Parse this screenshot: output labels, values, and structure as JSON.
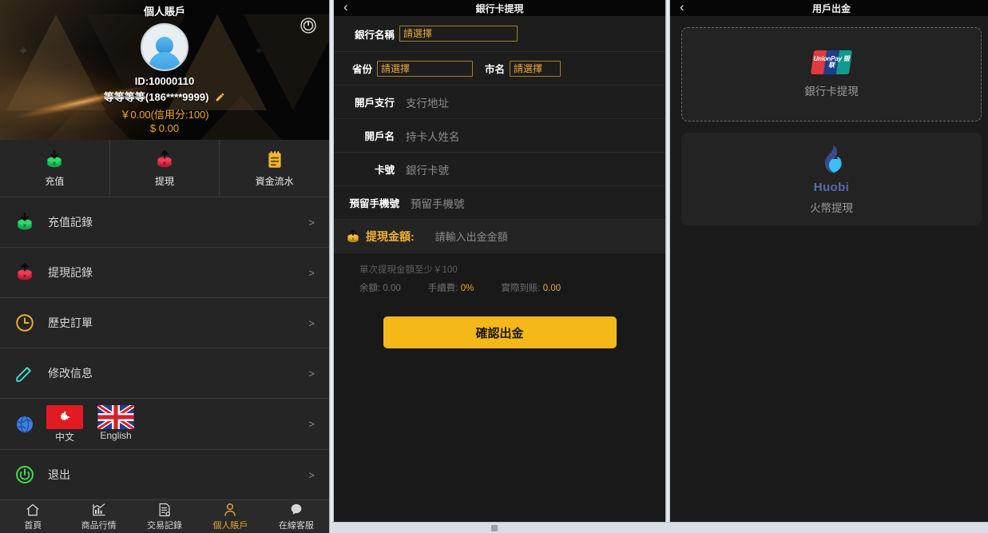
{
  "account_panel": {
    "title": "個人賬戶",
    "power_icon": "power-icon",
    "user_id": "ID:10000110",
    "user_name": "等等等等(186****9999)",
    "edit_icon": "pencil-icon",
    "balance_cny": "￥0.00(信用分:100)",
    "balance_usd": "$ 0.00",
    "quick_actions": [
      {
        "label": "充值",
        "icon": "deposit-icon",
        "color": "#22c55e"
      },
      {
        "label": "提現",
        "icon": "withdraw-icon",
        "color": "#e8344e"
      },
      {
        "label": "資金流水",
        "icon": "ledger-icon",
        "color": "#f0b135"
      }
    ],
    "menu": [
      {
        "label": "充值記錄",
        "icon": "deposit-icon",
        "arrow": ">"
      },
      {
        "label": "提現記錄",
        "icon": "withdraw-icon",
        "arrow": ">"
      },
      {
        "label": "歷史訂單",
        "icon": "clock-icon",
        "arrow": ">"
      },
      {
        "label": "修改信息",
        "icon": "pencil-icon",
        "arrow": ">"
      },
      {
        "label": "",
        "icon": "globe-icon",
        "arrow": ">"
      },
      {
        "label": "退出",
        "icon": "power-icon",
        "arrow": ">"
      }
    ],
    "languages": [
      {
        "label": "中文",
        "flag": "hk-flag-icon"
      },
      {
        "label": "English",
        "flag": "uk-flag-icon"
      }
    ],
    "tabbar": [
      {
        "label": "首頁",
        "icon": "home-icon",
        "active": false
      },
      {
        "label": "商品行情",
        "icon": "chart-icon",
        "active": false
      },
      {
        "label": "交易記錄",
        "icon": "records-icon",
        "active": false
      },
      {
        "label": "個人賬戶",
        "icon": "person-icon",
        "active": true
      },
      {
        "label": "在線客服",
        "icon": "support-icon",
        "active": false
      }
    ]
  },
  "bank_panel": {
    "title": "銀行卡提現",
    "back_icon": "chevron-left-icon",
    "bank_name_label": "銀行名稱",
    "bank_name_value": "請選擇",
    "province_label": "省份",
    "province_value": "請選擇",
    "city_label": "市名",
    "city_value": "請選擇",
    "branch_label": "開戶支行",
    "branch_placeholder": "支行地址",
    "holder_label": "開戶名",
    "holder_placeholder": "持卡人姓名",
    "card_label": "卡號",
    "card_placeholder": "銀行卡號",
    "phone_label": "預留手機號",
    "phone_placeholder": "預留手機號",
    "amount_label": "提現金額:",
    "amount_placeholder": "請輸入出金金額",
    "min_hint": "單次提現金額至少￥100",
    "stats": [
      {
        "key": "余額:",
        "value": "0.00",
        "gold": false
      },
      {
        "key": "手續費:",
        "value": "0%",
        "gold": true
      },
      {
        "key": "實際到賬:",
        "value": "0.00",
        "gold": true
      }
    ],
    "confirm_label": "確認出金"
  },
  "methods_panel": {
    "title": "用戶出金",
    "back_icon": "chevron-left-icon",
    "methods": [
      {
        "label": "銀行卡提現",
        "logo": "unionpay-logo",
        "logo_text": "UnionPay 银联",
        "selected": true
      },
      {
        "label": "火幣提現",
        "logo": "huobi-logo",
        "logo_text": "Huobi",
        "selected": false
      }
    ]
  },
  "colors": {
    "accent_gold": "#f0b135",
    "button_gold": "#f5b819",
    "green": "#22c55e",
    "red": "#e8344e",
    "panel_bg": "#1b1b1b"
  }
}
